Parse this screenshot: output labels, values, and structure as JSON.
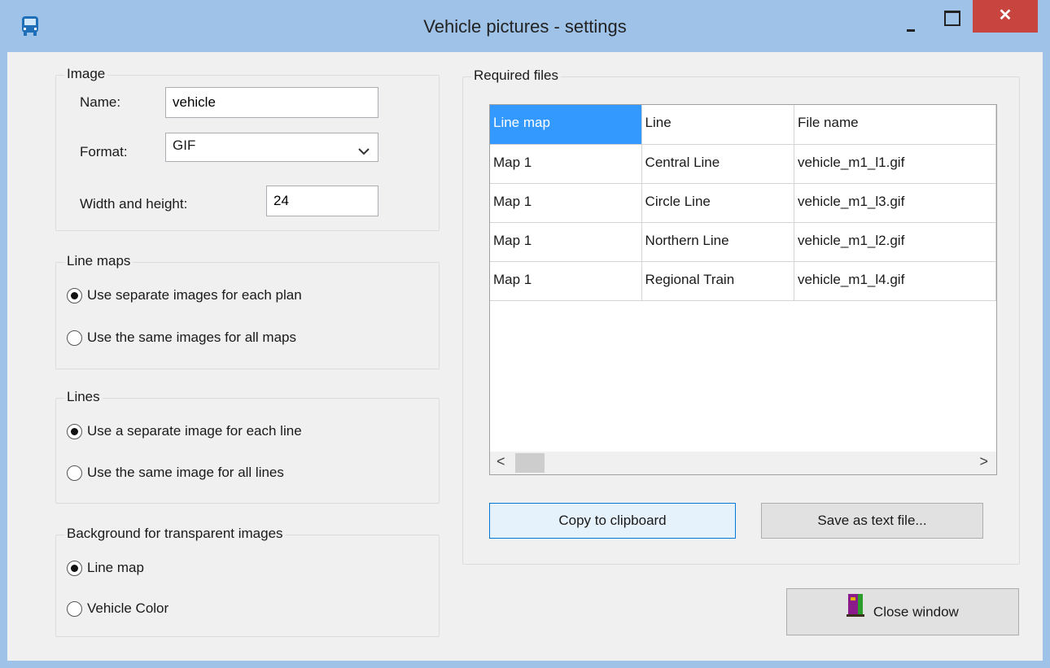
{
  "window": {
    "title": "Vehicle pictures - settings",
    "close_glyph": "✕"
  },
  "image_group": {
    "title": "Image",
    "name_label": "Name:",
    "name_value": "vehicle",
    "format_label": "Format:",
    "format_value": "GIF",
    "size_label": "Width and height:",
    "size_value": "24"
  },
  "line_maps_group": {
    "title": "Line maps",
    "options": [
      "Use separate images for each plan",
      "Use the same images for all maps"
    ],
    "selected": 0
  },
  "lines_group": {
    "title": "Lines",
    "options": [
      "Use a separate image for each line",
      "Use the same image for all lines"
    ],
    "selected": 0
  },
  "background_group": {
    "title": "Background for transparent images",
    "options": [
      "Line map",
      "Vehicle Color"
    ],
    "selected": 0
  },
  "files_group": {
    "title": "Required files",
    "columns": [
      "Line map",
      "Line",
      "File name"
    ],
    "rows": [
      [
        "Map 1",
        "Central Line",
        "vehicle_m1_l1.gif"
      ],
      [
        "Map 1",
        "Circle Line",
        "vehicle_m1_l3.gif"
      ],
      [
        "Map 1",
        "Northern Line",
        "vehicle_m1_l2.gif"
      ],
      [
        "Map 1",
        "Regional Train",
        "vehicle_m1_l4.gif"
      ]
    ],
    "scroll_left": "<",
    "scroll_right": ">"
  },
  "buttons": {
    "copy": "Copy to clipboard",
    "save": "Save as text file...",
    "close": "Close window"
  },
  "icons": {
    "app": "bus-icon",
    "close_window": "door-exit-icon"
  }
}
